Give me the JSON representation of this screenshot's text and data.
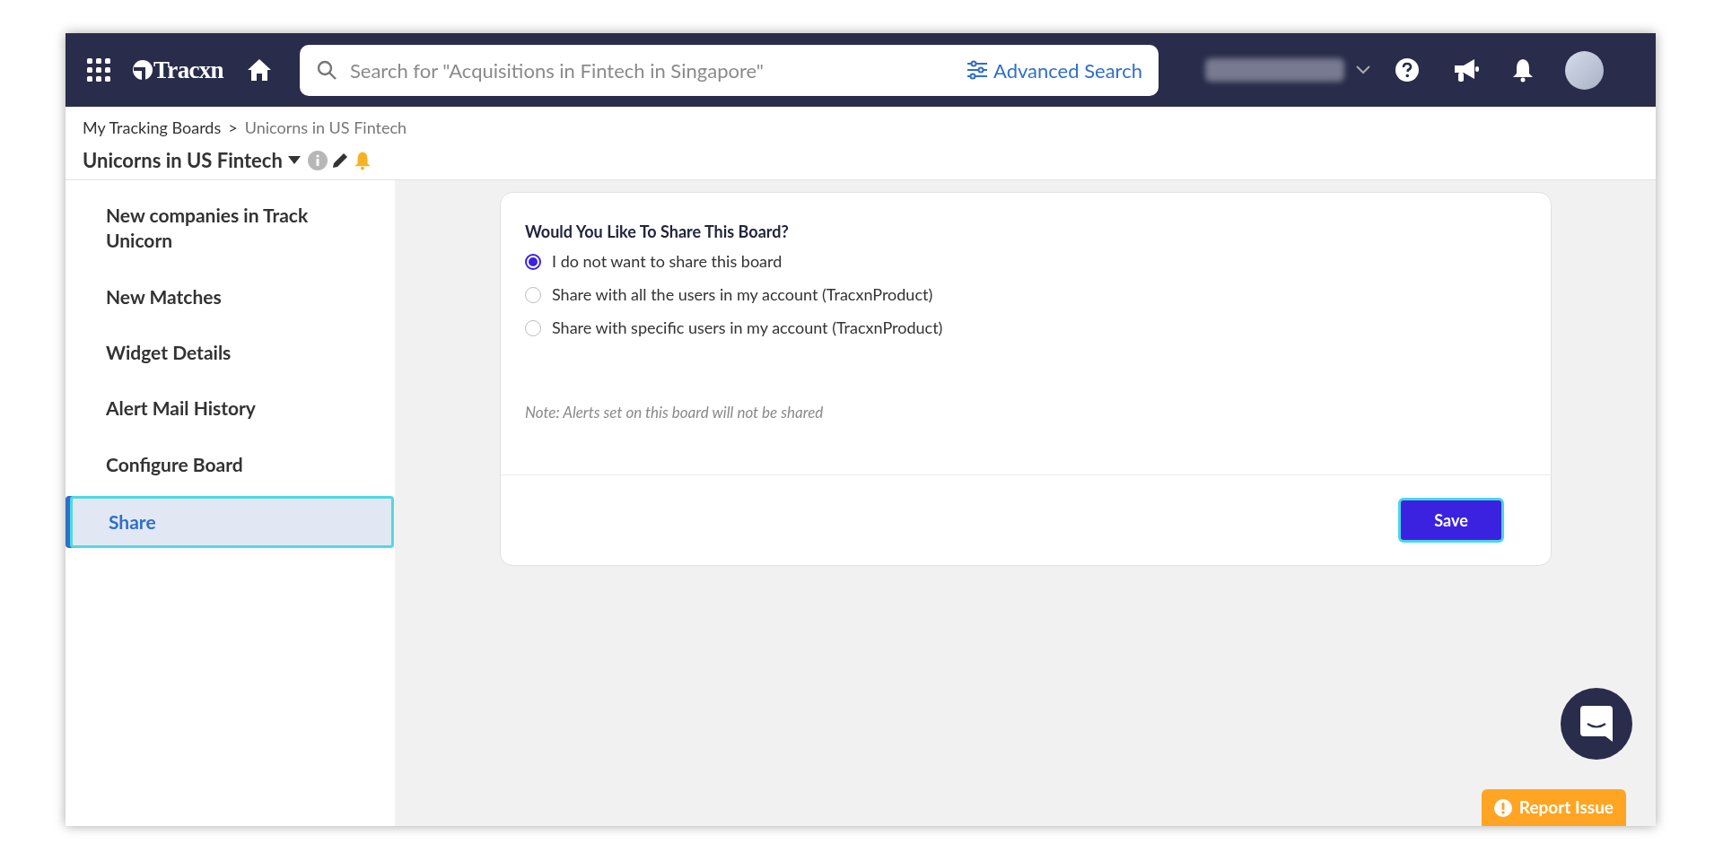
{
  "header": {
    "logo": "Tracxn",
    "search_placeholder": "Search for \"Acquisitions in Fintech in Singapore\"",
    "advanced_search": "Advanced Search"
  },
  "breadcrumb": [
    "My Tracking Boards",
    "Unicorns in US Fintech"
  ],
  "breadcrumb_separator": ">",
  "board_title": "Unicorns in US Fintech",
  "sidebar": {
    "items": [
      {
        "label": "New companies in Track Unicorn",
        "selected": false
      },
      {
        "label": "New Matches",
        "selected": false
      },
      {
        "label": "Widget Details",
        "selected": false
      },
      {
        "label": "Alert Mail History",
        "selected": false
      },
      {
        "label": "Configure Board",
        "selected": false
      },
      {
        "label": "Share",
        "selected": true
      }
    ]
  },
  "share": {
    "question": "Would You Like To Share This Board?",
    "options": [
      {
        "label": "I do not want to share this board",
        "selected": true
      },
      {
        "label": "Share with all the users in my account (TracxnProduct)",
        "selected": false
      },
      {
        "label": "Share with specific users in my account (TracxnProduct)",
        "selected": false
      }
    ],
    "note": "Note: Alerts set on this board will not be shared",
    "save": "Save"
  },
  "report_issue": "Report Issue"
}
